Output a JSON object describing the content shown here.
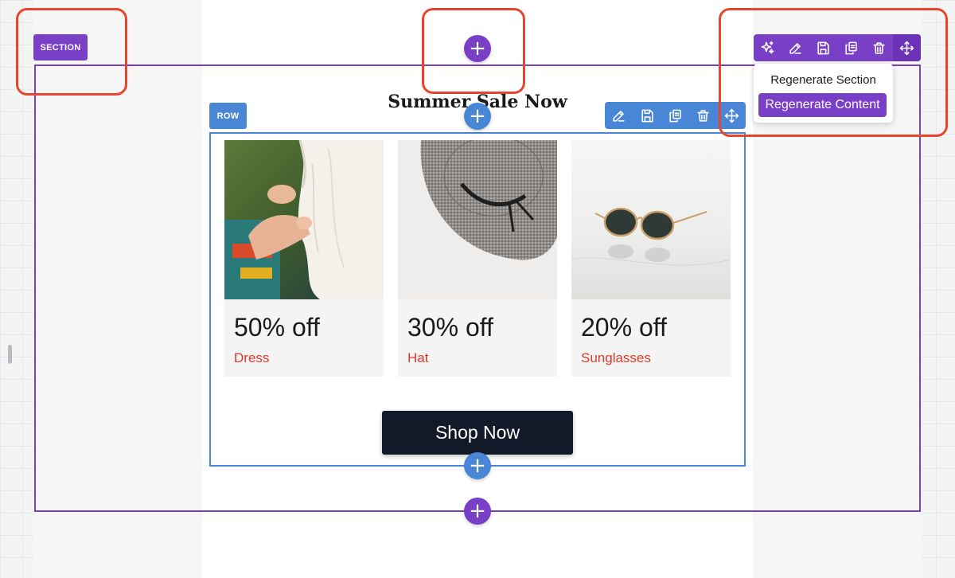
{
  "section": {
    "tag_label": "SECTION",
    "toolbar_icons": [
      "sparkles-icon",
      "edit-icon",
      "save-icon",
      "duplicate-icon",
      "delete-icon",
      "move-icon"
    ],
    "menu": {
      "regenerate_section": "Regenerate Section",
      "regenerate_content": "Regenerate Content"
    }
  },
  "row": {
    "tag_label": "ROW",
    "toolbar_icons": [
      "edit-icon",
      "save-icon",
      "duplicate-icon",
      "delete-icon",
      "move-icon"
    ]
  },
  "email": {
    "title": "Summer Sale Now",
    "cards": [
      {
        "discount": "50% off",
        "category": "Dress",
        "image": "dress-photo"
      },
      {
        "discount": "30% off",
        "category": "Hat",
        "image": "hat-photo"
      },
      {
        "discount": "20% off",
        "category": "Sunglasses",
        "image": "sunglasses-photo"
      }
    ],
    "cta_label": "Shop Now"
  },
  "add_buttons": {
    "symbol": "+"
  },
  "colors": {
    "section_accent": "#7a3fc7",
    "row_accent": "#4a86d6",
    "highlight": "#e8452c",
    "cta_background": "#121a2a",
    "category_text": "#e0392b"
  }
}
